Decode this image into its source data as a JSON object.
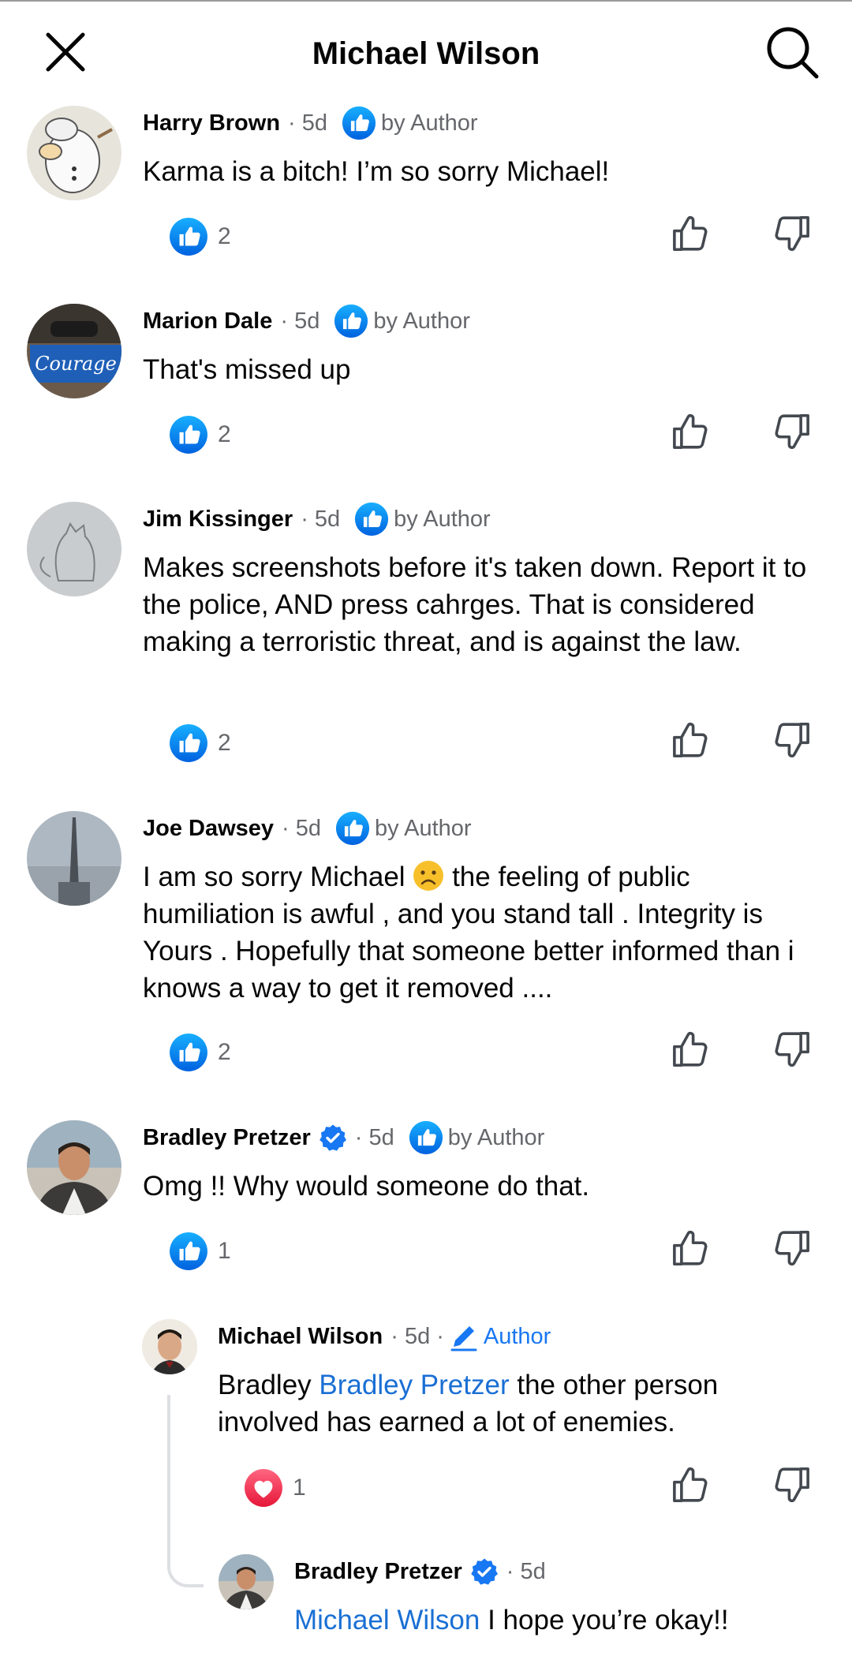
{
  "header": {
    "title": "Michael Wilson",
    "close_icon": "close-icon",
    "search_icon": "search-icon"
  },
  "colors": {
    "like_blue": "#1877f2",
    "love_red": "#f33e58",
    "mention_blue": "#1a6fd4",
    "meta_grey": "#65676b"
  },
  "comments": [
    {
      "name": "Harry Brown",
      "time": "5d",
      "author_like": "by Author",
      "text": "Karma is a bitch! I’m so sorry Michael!",
      "reaction": "like",
      "count": "2"
    },
    {
      "name": "Marion Dale",
      "time": "5d",
      "author_like": "by Author",
      "text": "That's missed up",
      "reaction": "like",
      "count": "2",
      "avatar_text": "Courage"
    },
    {
      "name": "Jim Kissinger",
      "time": "5d",
      "author_like": "by Author",
      "text": "Makes screenshots before it's taken down. Report it to the police, AND press cahrges. That is considered making a terroristic threat, and is against the law.",
      "reaction": "like",
      "count": "2"
    },
    {
      "name": "Joe Dawsey",
      "time": "5d",
      "author_like": "by Author",
      "text_before_emoji": "I am so sorry Michael",
      "text_after_emoji": "the feeling of public humiliation is awful , and you stand tall . Integrity is Yours . Hopefully that someone better informed than i knows a way to get it removed ....",
      "emoji": "frowning-face-emoji",
      "reaction": "like",
      "count": "2"
    },
    {
      "name": "Bradley Pretzer",
      "verified": true,
      "time": "5d",
      "author_like": "by Author",
      "text": "Omg !! Why would someone do that.",
      "reaction": "like",
      "count": "1"
    }
  ],
  "replies": [
    {
      "name": "Michael Wilson",
      "time": "5d",
      "author_tag": "Author",
      "text_prefix": "Bradley",
      "mention": "Bradley Pretzer",
      "text_suffix": "the other person involved has earned a lot of enemies.",
      "reaction": "love",
      "count": "1"
    },
    {
      "name": "Bradley Pretzer",
      "verified": true,
      "time": "5d",
      "mention": "Michael Wilson",
      "text_suffix": "I hope you’re okay!!"
    }
  ]
}
